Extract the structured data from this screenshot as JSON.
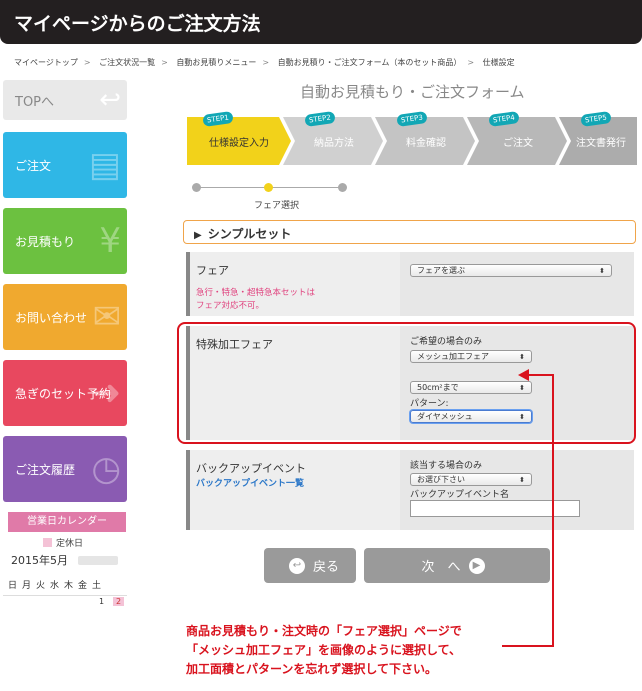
{
  "banner": {
    "title": "マイページからのご注文方法"
  },
  "breadcrumb": [
    "マイページトップ",
    "ご注文状況一覧",
    "自動お見積りメニュー",
    "自動お見積り・ご注文フォーム（本のセット商品）",
    "仕様設定"
  ],
  "breadcrumb_sep": ">",
  "sidebar": {
    "top": "TOPへ",
    "items": [
      {
        "label": "ご注文",
        "color": "#2fb7e6"
      },
      {
        "label": "お見積もり",
        "color": "#6cc140"
      },
      {
        "label": "お問い合わせ",
        "color": "#f0a92f"
      },
      {
        "label": "急ぎのセット予約",
        "color": "#e8485f"
      },
      {
        "label": "ご注文履歴",
        "color": "#8a5bb2"
      }
    ],
    "calendar": {
      "title": "営業日カレンダー",
      "legend": "定休日",
      "month": "2015年5月",
      "weekdays": "日月火水木金土",
      "day1": "1",
      "day2": "2"
    }
  },
  "form": {
    "title": "自動お見積もり・ご注文フォーム",
    "steps": [
      {
        "badge": "STEP1",
        "label": "仕様設定入力",
        "color": "#f2d21a",
        "text": "#333"
      },
      {
        "badge": "STEP2",
        "label": "納品方法",
        "color": "#d0d0d0",
        "text": "#fff"
      },
      {
        "badge": "STEP3",
        "label": "料金確認",
        "color": "#c4c4c4",
        "text": "#fff"
      },
      {
        "badge": "STEP4",
        "label": "ご注文",
        "color": "#b8b8b8",
        "text": "#fff"
      },
      {
        "badge": "STEP5",
        "label": "注文書発行",
        "color": "#acacac",
        "text": "#fff"
      }
    ],
    "progress_label": "フェア選択",
    "section": "シンプルセット",
    "rows": {
      "fair": {
        "label": "フェア",
        "warning_line1": "急行・特急・超特急本セットは",
        "warning_line2": "フェア対応不可。",
        "select": "フェアを選ぶ"
      },
      "special": {
        "label": "特殊加工フェア",
        "hint": "ご希望の場合のみ",
        "select1": "メッシュ加工フェア",
        "select2": "50cm²まで",
        "pattern_label": "パターン:",
        "select3": "ダイヤメッシュ"
      },
      "backup": {
        "label": "バックアップイベント",
        "link": "バックアップイベント一覧",
        "hint": "該当する場合のみ",
        "select": "お選び下さい",
        "name_label": "バックアップイベント名",
        "name_value": ""
      }
    },
    "back_button": "戻る",
    "next_button": "次　へ"
  },
  "note": {
    "line1": "商品お見積もり・注文時の「フェア選択」ページで",
    "line2": "「メッシュ加工フェア」を画像のように選択して、",
    "line3": "加工面積とパターンを忘れず選択して下さい。"
  }
}
